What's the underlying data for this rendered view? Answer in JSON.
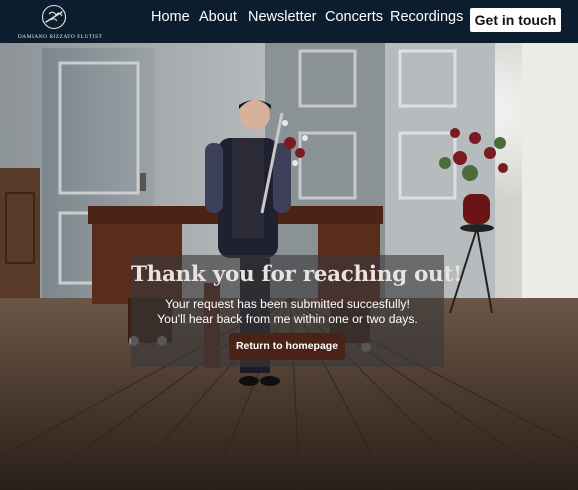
{
  "brand": {
    "logo_text": "DAMIANO RIZZATO FLUTIST"
  },
  "nav": {
    "items": [
      {
        "label": "Home"
      },
      {
        "label": "About"
      },
      {
        "label": "Newsletter"
      },
      {
        "label": "Concerts"
      },
      {
        "label": "Recordings"
      }
    ],
    "cta_label": "Get in touch"
  },
  "message": {
    "title": "Thank you for reaching out!",
    "line1": "Your request has been submitted succesfully!",
    "line2": "You'll hear back from me within one or two days.",
    "button_label": "Return to homepage"
  },
  "colors": {
    "navbar_bg": "#0c1e2e",
    "cta_bg": "#ffffff",
    "return_button_bg": "#4a2217",
    "overlay_bg": "#3a383a"
  },
  "icons": {
    "logo": "bird-and-flute-icon"
  }
}
